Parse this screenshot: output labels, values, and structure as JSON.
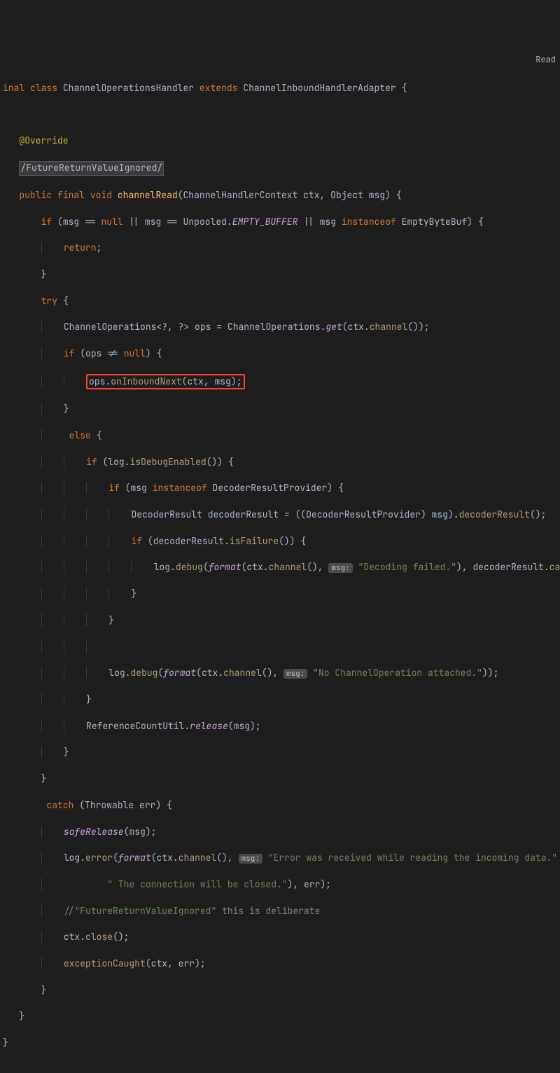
{
  "topRight": "Read",
  "sig": {
    "final": "inal",
    "class": "class",
    "className": "ChannelOperationsHandler",
    "extends": "extends",
    "superClass": "ChannelInboundHandlerAdapter",
    "brace": "{"
  },
  "ann": {
    "override": "@Override",
    "boxed": "/FutureReturnValueIgnored/"
  },
  "m": {
    "public": "public",
    "final": "final",
    "void": "void",
    "name": "channelRead",
    "p1t": "ChannelHandlerContext",
    "p1n": "ctx",
    "p2t": "Object",
    "p2n": "msg"
  },
  "body": {
    "if1": "if",
    "msg": "msg",
    "null": "null",
    "or": "||",
    "eq": "==",
    "unpooled": "Unpooled",
    "empty": "EMPTY_BUFFER",
    "instanceof": "instanceof",
    "emptyByteBuf": "EmptyByteBuf",
    "return": "return",
    "try": "try",
    "opsType": "ChannelOperations<?, ?>",
    "ops": "ops",
    "assign": "=",
    "channelOps": "ChannelOperations",
    "get": "get",
    "ctx": "ctx",
    "channel": "channel",
    "ne": "!=",
    "onInboundNext": "onInboundNext",
    "else": "else",
    "log": "log",
    "isDebugEnabled": "isDebugEnabled",
    "decoderResultProvider": "DecoderResultProvider",
    "decoderResultT": "DecoderResult",
    "decoderResultV": "decoderResult",
    "decoderResultM": "decoderResult",
    "isFailure": "isFailure",
    "debug": "debug",
    "format": "format",
    "hintMsg": "msg:",
    "strDecodingFailed": "\"Decoding failed.\"",
    "cause": "cause",
    "strNoChannel": "\"No ChannelOperation attached.\"",
    "refCountUtil": "ReferenceCountUtil",
    "release": "release",
    "catch": "catch",
    "throwable": "Throwable",
    "err": "err",
    "safeRelease": "safeRelease",
    "error": "error",
    "strErr1": "\"Error was received while reading the incoming data.\"",
    "plus": "+",
    "strErr2": "\" The connection will be closed.\"",
    "commentSlash": "//",
    "commentQ": "\"FutureReturnValueIgnored\"",
    "commentRest": " this is deliberate",
    "close": "close",
    "exceptionCaught": "exceptionCaught"
  }
}
